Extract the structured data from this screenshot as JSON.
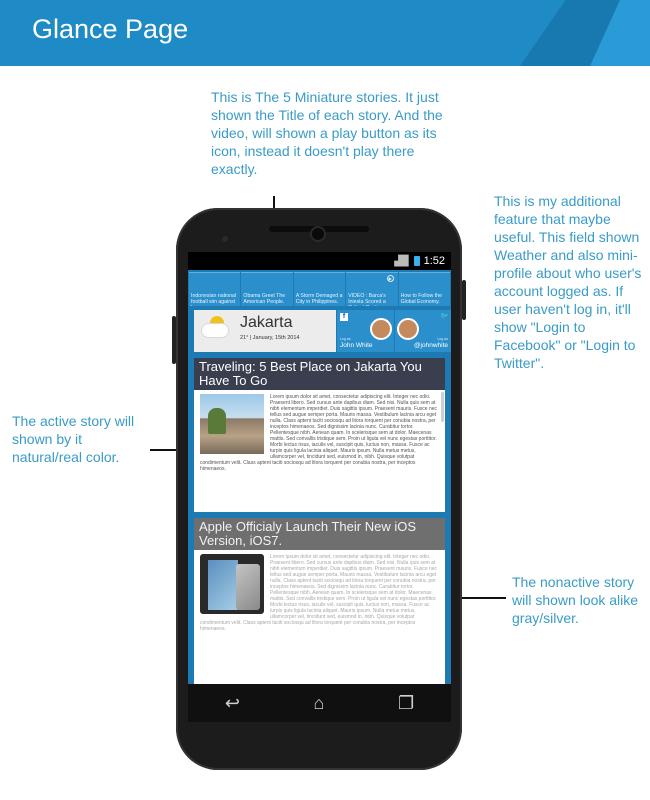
{
  "header": {
    "title": "Glance Page"
  },
  "annotations": {
    "top": "This is The 5 Miniature stories. It just shown the Title of each story. And the video, will shown a play button as its icon, instead it doesn't play there exactly.",
    "right": "This is my additional feature that maybe useful. This field shown Weather and also mini-profile about who user's account logged as. If user haven't log in, it'll show \"Login to Facebook\" or \"Login to Twitter\".",
    "left": "The active story will shown by it natural/real color.",
    "bottom": "The nonactive story will shown look alike gray/silver."
  },
  "status_bar": {
    "time": "1:52",
    "battery_color": "#3ab0ea"
  },
  "mini_stories": [
    {
      "title": "Indonesian national football win against Laos.",
      "video": false
    },
    {
      "title": "Obama Greet The American People.",
      "video": false
    },
    {
      "title": "A Storm Demaged a City in Philippines.",
      "video": false
    },
    {
      "title": "VIDEO : Barca's Iniesta Scored a Critical Goal",
      "video": true,
      "icon": "play-icon"
    },
    {
      "title": "How to Follow the Global Economy.",
      "video": false
    }
  ],
  "weather": {
    "city": "Jakarta",
    "temp_date": "21° | January, 15th 2014",
    "icon": "partly-cloudy-icon"
  },
  "profile": {
    "facebook": {
      "icon": "facebook-icon",
      "label": "Log as",
      "name": "John White"
    },
    "twitter": {
      "icon": "twitter-icon",
      "label": "Log as",
      "name": "@johnwhite"
    }
  },
  "stories": [
    {
      "state": "active",
      "title": "Traveling: 5 Best Place on Jakarta You Have To Go",
      "body": "Lorem ipsum dolor sit amet, consectetur adipiscing elit. Integer nec odio. Praesent libero. Sed cursus ante dapibus diam. Sed nisi. Nulla quis sem at nibh elementum imperdiet. Duis sagittis ipsum. Praesent mauris. Fusce nec tellus sed augue semper porta. Mauris massa. Vestibulum lacinia arcu eget nulla. Class aptent taciti sociosqu ad litora torquent per conubia nostra, per inceptos himenaeos. Sed dignissim lacinia nunc. Curabitur tortor. Pellentesque nibh. Aenean quam. In scelerisque sem at dolor. Maecenas mattis. Sed convallis tristique sem. Proin ut ligula vel nunc egestas porttitor. Morbi lectus risus, iaculis vel, suscipit quis, luctus non, massa. Fusce ac turpis quis ligula lacinia aliquet. Mauris ipsum. Nulla metus metus, ullamcorper vel, tincidunt sed, euismod in, nibh. Quisque volutpat condimentum velit. Class aptent taciti sociosqu ad litora torquent per conubia nostra, per inceptos himenaeos."
    },
    {
      "state": "inactive",
      "title": "Apple Officialy Launch Their New iOS Version, iOS7.",
      "body": "Lorem ipsum dolor sit amet, consectetur adipiscing elit. Integer nec odio. Praesent libero. Sed cursus ante dapibus diam. Sed nisi. Nulla quis sem at nibh elementum imperdiet. Duis sagittis ipsum. Praesent mauris. Fusce nec tellus sed augue semper porta. Mauris massa. Vestibulum lacinia arcu eget nulla. Class aptent taciti sociosqu ad litora torquent per conubia nostra, per inceptos himenaeos. Sed dignissim lacinia nunc. Curabitur tortor. Pellentesque nibh. Aenean quam. In scelerisque sem at dolor. Maecenas mattis. Sed convallis tristique sem. Proin ut ligula vel nunc egestas porttitor. Morbi lectus risus, iaculis vel, suscipit quis, luctus non, massa. Fusce ac turpis quis ligula lacinia aliquet. Mauris ipsum. Nulla metus metus, ullamcorper vel, tincidunt sed, euismod in, nibh. Quisque volutpat condimentum velit. Class aptent taciti sociosqu ad litora torquent per conubia nostra, per inceptos himenaeos."
    }
  ],
  "nav": {
    "back": "back-icon",
    "home": "home-icon",
    "recents": "recents-icon"
  },
  "colors": {
    "banner": "#1e8bc6",
    "annotation_text": "#3a9bc7",
    "active_title_bg": "#3a3f50",
    "inactive_title_bg": "#6f6f6f"
  }
}
